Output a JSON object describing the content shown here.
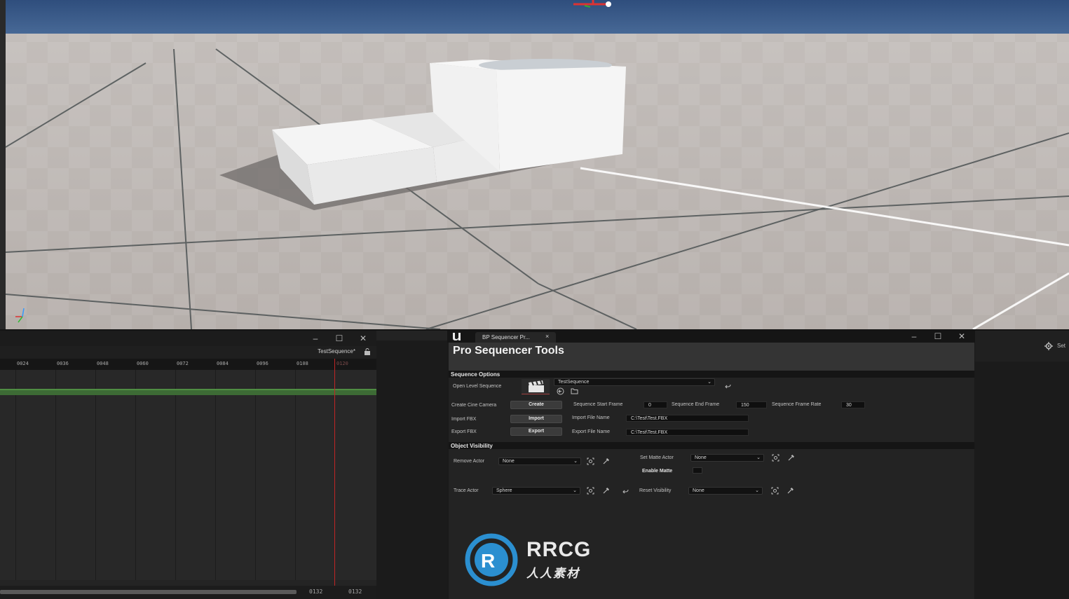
{
  "sequencer": {
    "sequence_name": "TestSequence*",
    "ruler_ticks": [
      "0024",
      "0036",
      "0048",
      "0060",
      "0072",
      "0084",
      "0096",
      "0108",
      "0120"
    ],
    "footer_start": "0132",
    "footer_end": "0132",
    "window_buttons": {
      "minimize": "–",
      "maximize": "☐",
      "close": "✕"
    }
  },
  "right_panel": {
    "settings_label": "Set"
  },
  "tool_window": {
    "tab_label": "BP Sequencer Pr...",
    "tab_close": "×",
    "title": "Pro Sequencer Tools",
    "window_buttons": {
      "minimize": "–",
      "maximize": "☐",
      "close": "✕"
    },
    "sequence_options": {
      "section_label": "Sequence Options",
      "open_level_sequence_label": "Open Level Sequence",
      "level_sequence_value": "TestSequence",
      "create_cine_camera_label": "Create Cine Camera",
      "create_button": "Create",
      "start_frame_label": "Sequence Start Frame",
      "start_frame_value": "0",
      "end_frame_label": "Sequence End Frame",
      "end_frame_value": "150",
      "frame_rate_label": "Sequence Frame Rate",
      "frame_rate_value": "30",
      "import_fbx_label": "Import FBX",
      "import_button": "Import",
      "import_file_label": "Import File Name",
      "import_file_value": "C:\\Test\\Test.FBX",
      "export_fbx_label": "Export FBX",
      "export_button": "Export",
      "export_file_label": "Export File Name",
      "export_file_value": "C:\\Test\\Test.FBX"
    },
    "object_visibility": {
      "section_label": "Object Visibility",
      "remove_actor_label": "Remove Actor",
      "remove_actor_value": "None",
      "set_matte_actor_label": "Set Matte Actor",
      "set_matte_actor_value": "None",
      "enable_matte_label": "Enable Matte",
      "trace_actor_label": "Trace Actor",
      "trace_actor_value": "Sphere",
      "reset_visibility_label": "Reset Visibility",
      "reset_visibility_value": "None"
    }
  },
  "watermark": {
    "text": "RRCG",
    "sub": "人人素材"
  },
  "colors": {
    "playhead": "#c02525",
    "track": "#3d6b35",
    "sky": "#3e5f8f",
    "floor": "#b8b2ad"
  }
}
